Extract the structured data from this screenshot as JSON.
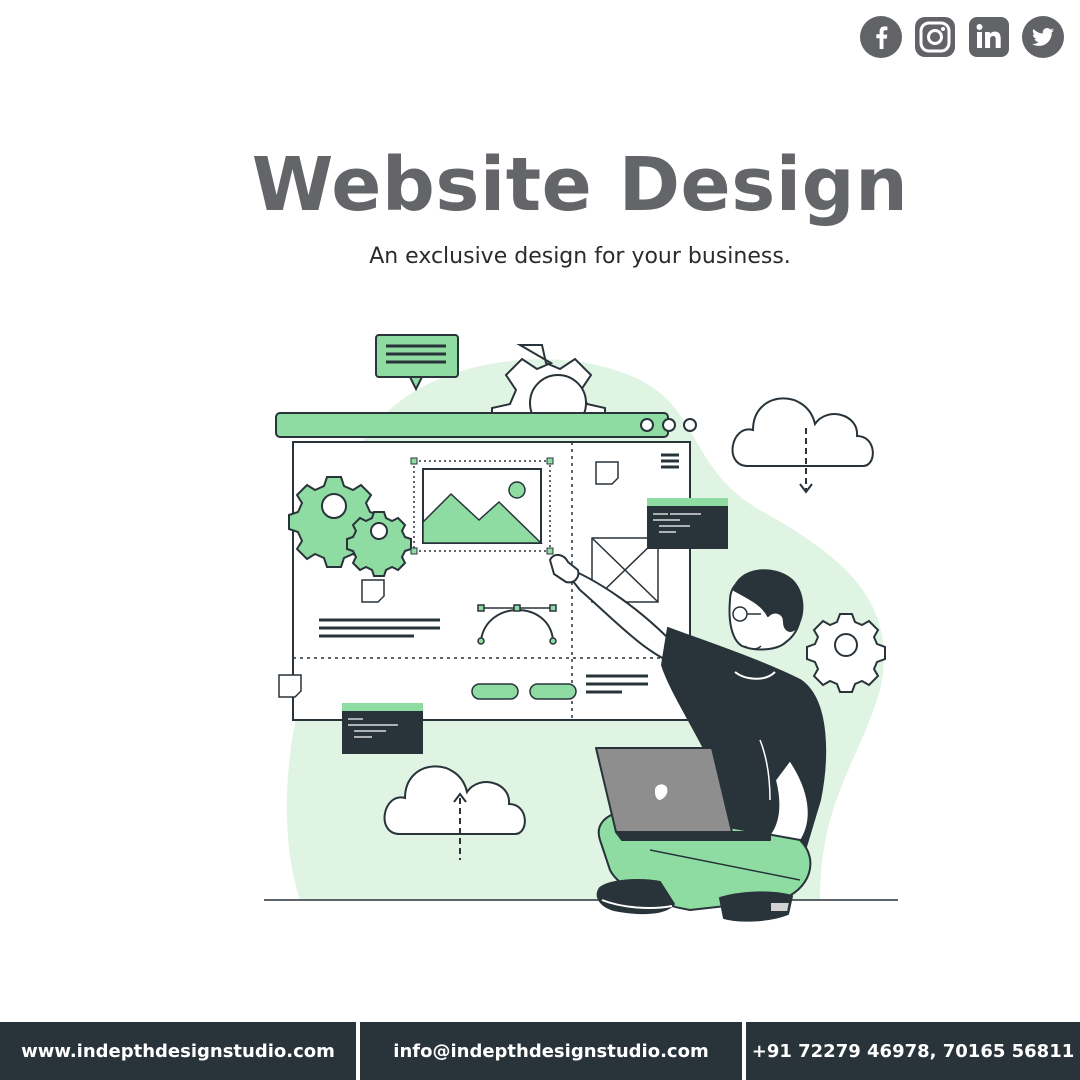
{
  "social": [
    {
      "icon": "facebook-icon",
      "label": "Facebook"
    },
    {
      "icon": "instagram-icon",
      "label": "Instagram"
    },
    {
      "icon": "linkedin-icon",
      "label": "LinkedIn"
    },
    {
      "icon": "twitter-icon",
      "label": "Twitter"
    }
  ],
  "hero": {
    "title": "Website Design",
    "subtitle": "An exclusive design for your business."
  },
  "footer": {
    "website": "www.indepthdesignstudio.com",
    "email": "info@indepthdesignstudio.com",
    "phone": "+91 72279 46978, 70165 56811"
  },
  "colors": {
    "title": "#646568",
    "accent_green": "#8fdca3",
    "blob_green": "#dff4e3",
    "dark": "#29333a",
    "icon_gray": "#616366"
  }
}
